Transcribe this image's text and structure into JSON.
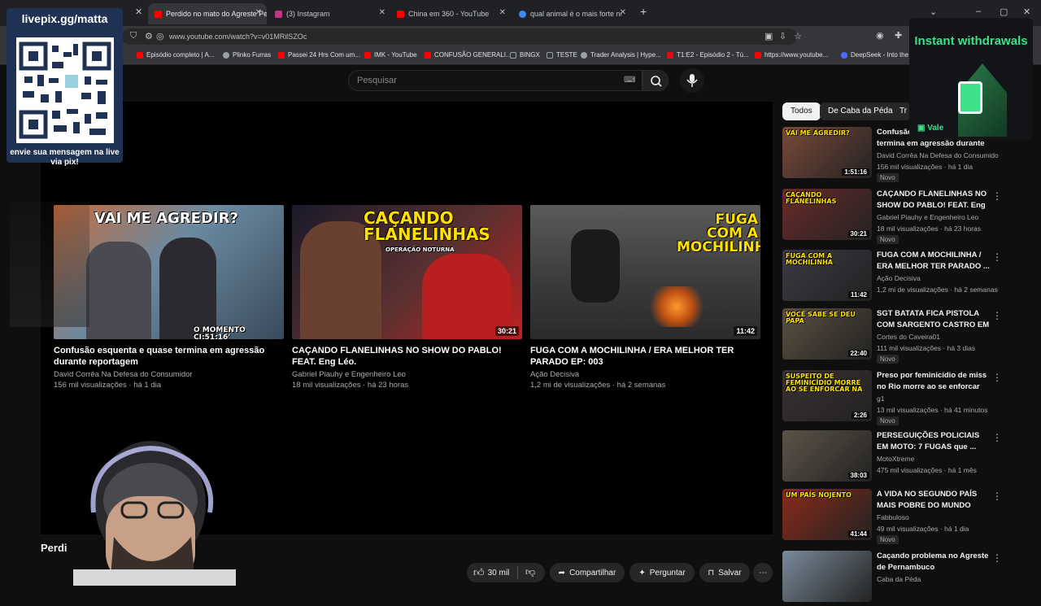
{
  "browser": {
    "tabs": [
      {
        "title": "Perdido no mato do Agreste Pe",
        "active": true,
        "color": "#ff0000"
      },
      {
        "title": "(3) Instagram",
        "active": false,
        "color": "#c13584"
      },
      {
        "title": "China em 360 - YouTube",
        "active": false,
        "color": "#ff0000"
      },
      {
        "title": "qual animal é o mais forte no ar",
        "active": false,
        "color": "#4285f4"
      }
    ],
    "url": "www.youtube.com/watch?v=v01MRilSZOc",
    "bookmarks": [
      {
        "label": "Episódio completo | A...",
        "color": "#ff0000"
      },
      {
        "label": "Plinko Furras",
        "color": "#9aa0a6"
      },
      {
        "label": "Passei 24 Hrs Com um...",
        "color": "#ff0000"
      },
      {
        "label": "IMK - YouTube",
        "color": "#ff0000"
      },
      {
        "label": "CONFUSÃO GENERALI...",
        "color": "#ff0000"
      },
      {
        "label": "BINGX",
        "color": "#9aa0a6"
      },
      {
        "label": "TESTE",
        "color": "#9aa0a6"
      },
      {
        "label": "Trader Analysis | Hype...",
        "color": "#9aa0a6"
      },
      {
        "label": "T1:E2 - Episódio 2 - Tú...",
        "color": "#e50914"
      },
      {
        "label": "https://www.youtube...",
        "color": "#ff0000"
      },
      {
        "label": "DeepSeek - Into the ...",
        "color": "#4d6bfe"
      }
    ]
  },
  "youtube": {
    "search_placeholder": "Pesquisar",
    "end_cards": [
      {
        "title": "Confusão esquenta e quase termina em agressão durante reportagem",
        "channel": "David Corrêa Na Defesa do Consumidor",
        "meta": "156 mil visualizações · há 1 dia",
        "thumb_text": "VAI ME AGREDIR?",
        "thumb_caption": "O MOMENTO CI:51:16'",
        "duration": ""
      },
      {
        "title": "CAÇANDO FLANELINHAS NO SHOW DO PABLO! FEAT. Eng Léo.",
        "channel": "Gabriel Piauhy e Engenheiro Leo",
        "meta": "18 mil visualizações · há 23 horas",
        "thumb_text": "CAÇANDO FLANELINHAS",
        "thumb_caption": "OPERAÇÃO NOTURNA",
        "duration": "30:21"
      },
      {
        "title": "FUGA COM A MOCHILINHA / ERA MELHOR TER PARADO EP: 003",
        "channel": "Ação Decisiva",
        "meta": "1,2 mi de visualizações · há 2 semanas",
        "thumb_text": "FUGA COM A MOCHILINHA",
        "thumb_caption": "",
        "duration": "11:42"
      }
    ],
    "video_title_partial": "Perdi",
    "actions": {
      "likes": "30 mil",
      "share": "Compartilhar",
      "ask": "Perguntar",
      "save": "Salvar"
    },
    "chips": [
      "Todos",
      "De Caba da Péda",
      "Tr"
    ],
    "recommendations": [
      {
        "title": "Confusão esquenta e quase termina em agressão durante ...",
        "channel": "David Corrêa Na Defesa do Consumidor",
        "meta": "156 mil visualizações · há 1 dia",
        "duration": "1:51:16",
        "new": "Novo",
        "thumb_color": "#7a4a3a"
      },
      {
        "title": "CAÇANDO FLANELINHAS NO SHOW DO PABLO! FEAT. Eng ...",
        "channel": "Gabriel Piauhy e Engenheiro Leo",
        "meta": "18 mil visualizações · há 23 horas",
        "duration": "30:21",
        "new": "Novo",
        "thumb_color": "#6b2a2a"
      },
      {
        "title": "FUGA COM A MOCHILINHA / ERA MELHOR TER PARADO ...",
        "channel": "Ação Decisiva",
        "meta": "1,2 mi de visualizações · há 2 semanas",
        "duration": "11:42",
        "new": "",
        "thumb_color": "#3a3a44"
      },
      {
        "title": "SGT BATATA FICA PISTOLA COM SARGENTO CASTRO EM ...",
        "channel": "Cortes do Caveira01",
        "meta": "111 mil visualizações · há 3 dias",
        "duration": "22:40",
        "new": "Novo",
        "thumb_color": "#5a5040"
      },
      {
        "title": "Preso por feminicídio de miss no Rio morre ao se enforcar n...",
        "channel": "g1",
        "meta": "13 mil visualizações · há 41 minutos",
        "duration": "2:26",
        "new": "Novo",
        "thumb_color": "#3a3030"
      },
      {
        "title": "PERSEGUIÇÕES POLICIAIS EM MOTO: 7 FUGAS que ...",
        "channel": "MotoXtreme",
        "meta": "475 mil visualizações · há 1 mês",
        "duration": "38:03",
        "new": "",
        "thumb_color": "#5c5448"
      },
      {
        "title": "A VIDA NO SEGUNDO PAÍS MAIS POBRE DO MUNDO",
        "channel": "Fabbuloso",
        "meta": "49 mil visualizações · há 1 dia",
        "duration": "41:44",
        "new": "Novo",
        "thumb_color": "#8a2a1a"
      },
      {
        "title": "Caçando problema no Agreste de Pernambuco",
        "channel": "Caba da Péda",
        "meta": "",
        "duration": "",
        "new": "",
        "thumb_color": "#7a8a9a"
      }
    ],
    "rec_thumb_texts": [
      "VAI ME AGREDIR?",
      "CAÇANDO FLANELINHAS",
      "FUGA COM A MOCHILINHA",
      "VOCÊ SABE SE DEU PAPA",
      "SUSPEITO DE FEMINICÍDIO MORRE AO SE ENFORCAR NA",
      "",
      "UM PAÍS NOJENTO",
      ""
    ]
  },
  "overlays": {
    "qr_title": "livepix.gg/matta",
    "qr_caption": "envie sua mensagem na live via pix!",
    "ad_text": "Instant withdrawals",
    "ad_badge": "Vale"
  },
  "colors": {
    "background": "#0f0f0f",
    "accent_red": "#ff0000",
    "ad_green": "#3ee08a",
    "qr_panel": "#1f3254"
  }
}
